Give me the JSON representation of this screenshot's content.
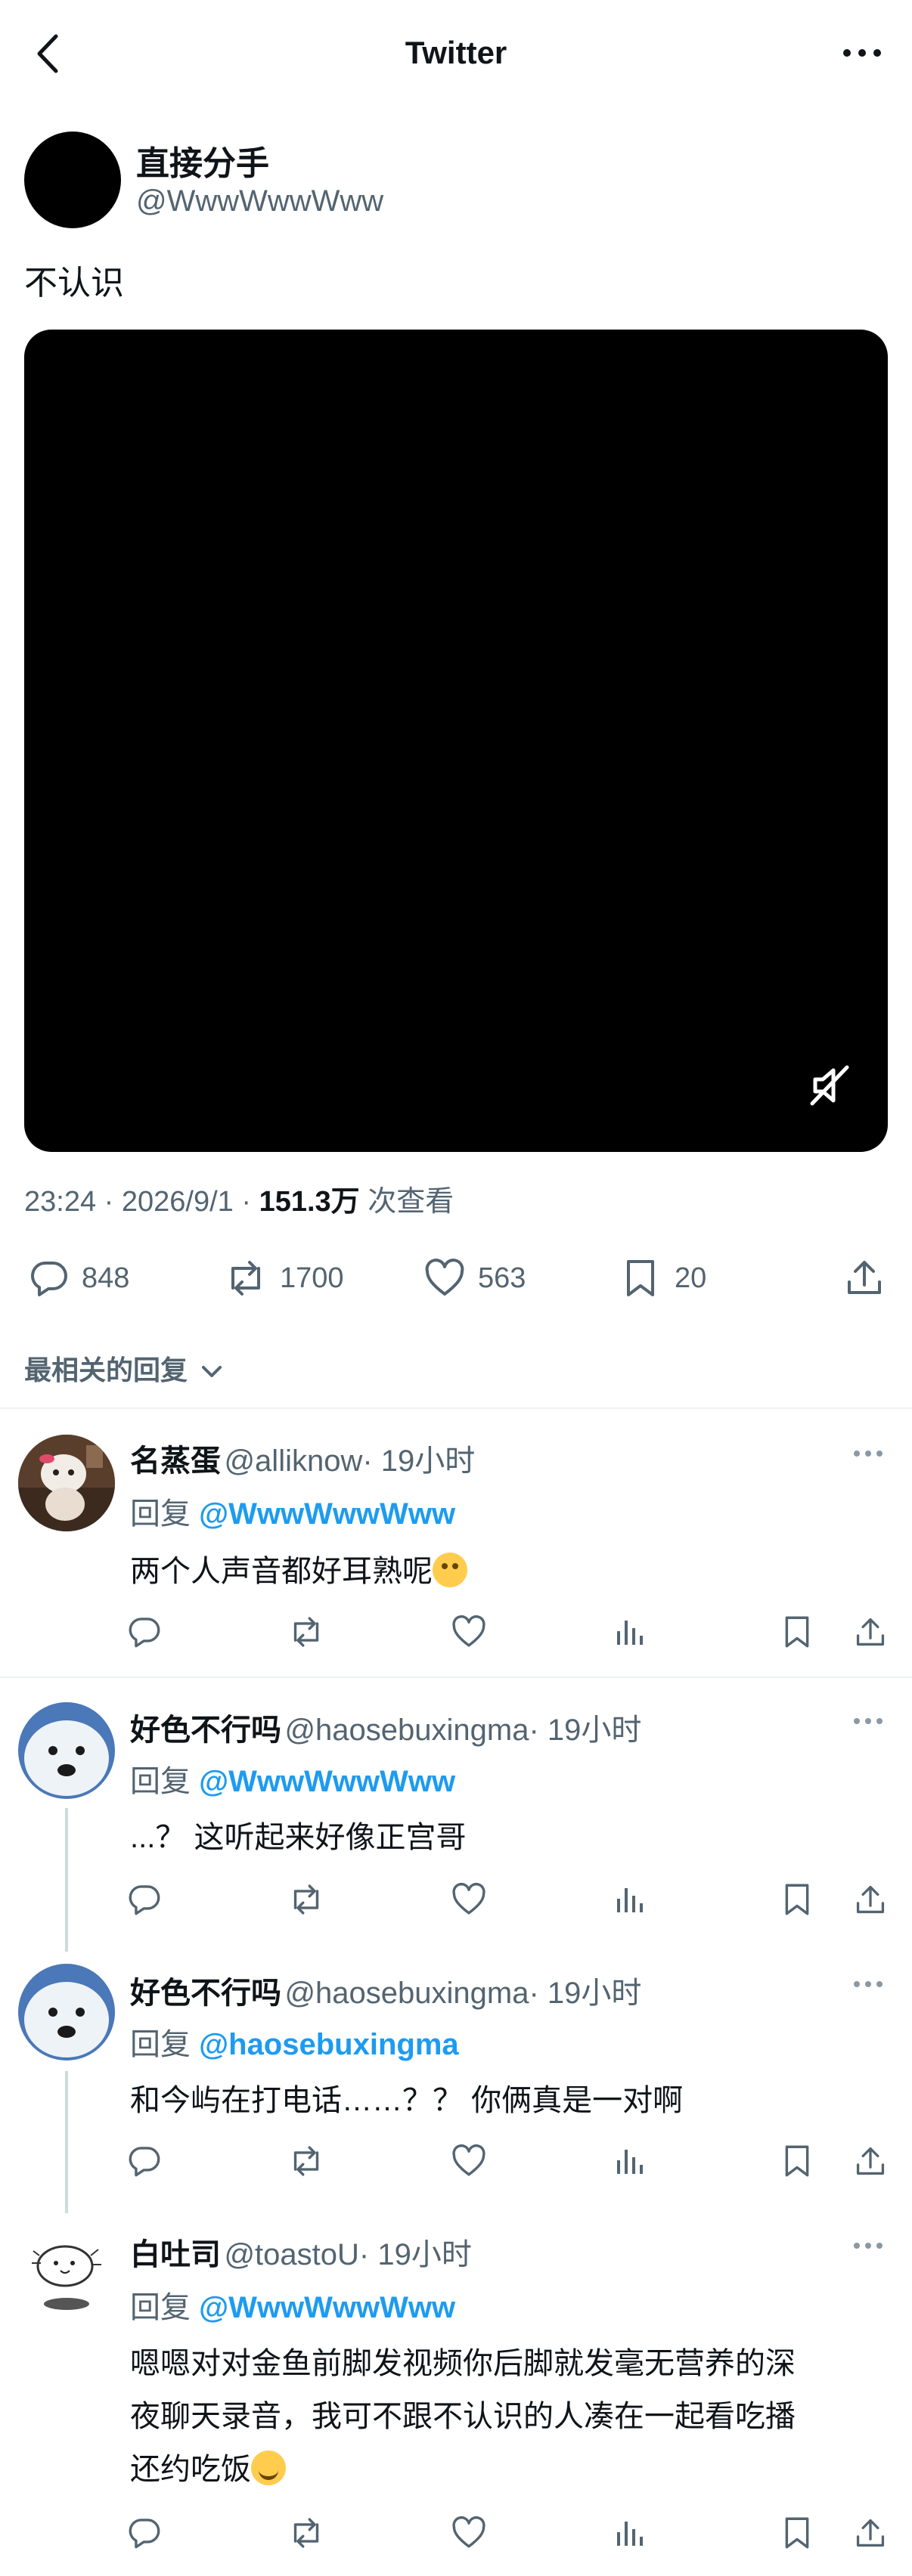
{
  "nav": {
    "title": "Twitter"
  },
  "post": {
    "author_name": "直接分手",
    "author_handle": "@WwwWwwWww",
    "text": "不认识",
    "meta_time": "23:24 · 2026/9/1 ·",
    "views_value": "151.3万",
    "views_label": "次查看",
    "replies": "848",
    "retweets": "1700",
    "likes": "563",
    "bookmarks": "20"
  },
  "sort": {
    "label": "最相关的回复"
  },
  "replies": [
    {
      "name": "名蒸蛋",
      "handle": "@alliknow",
      "time": "· 19小时",
      "reply_prefix": "回复",
      "reply_to": "@WwwWwwWww",
      "text": "两个人声音都好耳熟呢"
    },
    {
      "name": "好色不行吗",
      "handle": "@haosebuxingma",
      "time": "· 19小时",
      "reply_prefix": "回复",
      "reply_to": "@WwwWwwWww",
      "text": "...？ 这听起来好像正宫哥"
    },
    {
      "name": "好色不行吗",
      "handle": "@haosebuxingma",
      "time": "· 19小时",
      "reply_prefix": "回复",
      "reply_to": "@haosebuxingma",
      "text": "和今屿在打电话……？？ 你俩真是一对啊"
    },
    {
      "name": "白吐司",
      "handle": "@toastoU",
      "time": "· 19小时",
      "reply_prefix": "回复",
      "reply_to": "@WwwWwwWww",
      "text_lines": [
        "嗯嗯对对金鱼前脚发视频你后脚就发毫无营养的深",
        "夜聊天录音，我可不跟不认识的人凑在一起看吃播",
        "还约吃饭"
      ]
    }
  ],
  "colors": {
    "accent": "#1d9bf0",
    "muted": "#536471",
    "divider": "#eff3f4"
  }
}
